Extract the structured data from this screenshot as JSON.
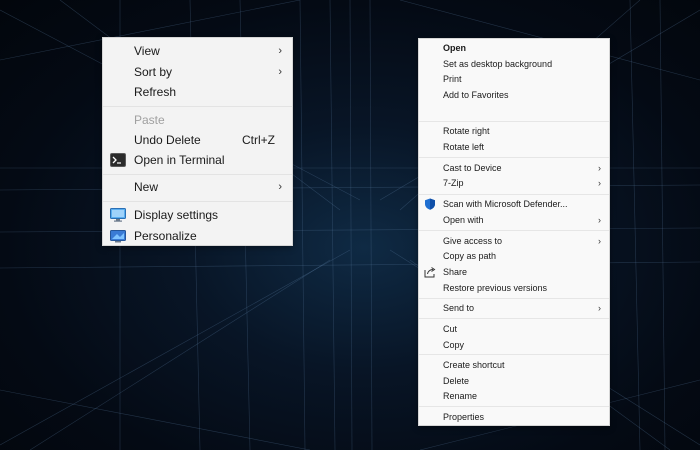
{
  "desktop_menu": {
    "items": [
      {
        "label": "View",
        "submenu": true
      },
      {
        "label": "Sort by",
        "submenu": true
      },
      {
        "label": "Refresh"
      },
      {
        "label": "Paste",
        "disabled": true
      },
      {
        "label": "Undo Delete",
        "shortcut": "Ctrl+Z"
      },
      {
        "label": "Open in Terminal",
        "icon": "terminal-icon"
      },
      {
        "label": "New",
        "submenu": true
      },
      {
        "label": "Display settings",
        "icon": "display-settings-icon"
      },
      {
        "label": "Personalize",
        "icon": "personalize-icon"
      }
    ],
    "submenu_glyph": "›"
  },
  "file_menu": {
    "items": [
      {
        "label": "Open",
        "bold": true
      },
      {
        "label": "Set as desktop background"
      },
      {
        "label": "Print"
      },
      {
        "label": "Add to Favorites"
      },
      {
        "label": "Rotate right"
      },
      {
        "label": "Rotate left"
      },
      {
        "label": "Cast to Device",
        "submenu": true
      },
      {
        "label": "7-Zip",
        "submenu": true
      },
      {
        "label": "Scan with Microsoft Defender...",
        "icon": "defender-shield-icon"
      },
      {
        "label": "Open with",
        "submenu": true
      },
      {
        "label": "Give access to",
        "submenu": true
      },
      {
        "label": "Copy as path"
      },
      {
        "label": "Share",
        "icon": "share-icon"
      },
      {
        "label": "Restore previous versions"
      },
      {
        "label": "Send to",
        "submenu": true
      },
      {
        "label": "Cut"
      },
      {
        "label": "Copy"
      },
      {
        "label": "Create shortcut"
      },
      {
        "label": "Delete"
      },
      {
        "label": "Rename"
      },
      {
        "label": "Properties"
      }
    ],
    "submenu_glyph": "›"
  },
  "colors": {
    "menu_background": "#f3f3f3",
    "disabled_text": "#a0a0a0",
    "defender_blue": "#1f6fd1"
  }
}
